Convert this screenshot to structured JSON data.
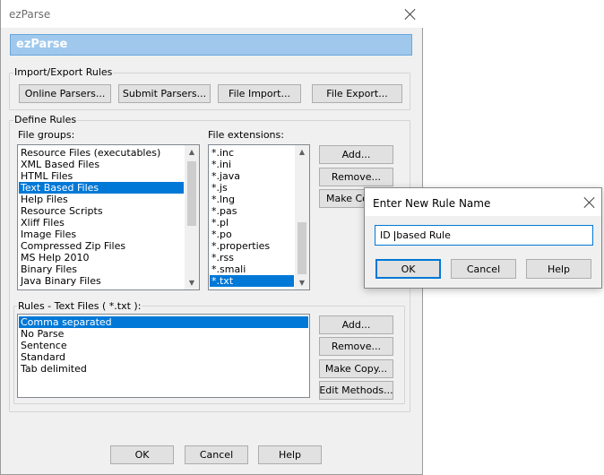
{
  "window": {
    "title": "ezParse"
  },
  "banner": {
    "title": "ezParse"
  },
  "import_export": {
    "label": "Import/Export Rules",
    "buttons": {
      "online": "Online Parsers...",
      "submit": "Submit Parsers...",
      "import": "File Import...",
      "export": "File Export..."
    }
  },
  "define": {
    "label": "Define Rules",
    "file_groups_label": "File groups:",
    "file_extensions_label": "File extensions:",
    "file_groups": [
      "Resource Files (executables)",
      "XML Based Files",
      "HTML Files",
      "Text Based Files",
      "Help Files",
      "Resource Scripts",
      "Xliff Files",
      "Image Files",
      "Compressed Zip Files",
      "MS Help 2010",
      "Binary Files",
      "Java Binary Files"
    ],
    "file_groups_selected": "Text Based Files",
    "file_extensions": [
      "*.inc",
      "*.ini",
      "*.java",
      "*.js",
      "*.lng",
      "*.pas",
      "*.pl",
      "*.po",
      "*.properties",
      "*.rss",
      "*.smali",
      "*.txt"
    ],
    "file_extensions_selected": "*.txt",
    "ext_buttons": {
      "add": "Add...",
      "remove": "Remove...",
      "make_copy": "Make Copy..."
    }
  },
  "rules": {
    "label": "Rules - Text Files ( *.txt ):",
    "items": [
      "Comma separated",
      "No Parse",
      "Sentence",
      "Standard",
      "Tab delimited"
    ],
    "selected": "Comma separated",
    "buttons": {
      "add": "Add...",
      "remove": "Remove...",
      "make_copy": "Make Copy...",
      "edit_methods": "Edit Methods..."
    }
  },
  "footer": {
    "ok": "OK",
    "cancel": "Cancel",
    "help": "Help"
  },
  "dialog": {
    "title": "Enter New Rule Name",
    "input_before_caret": "ID ",
    "input_after_caret": "based Rule",
    "ok": "OK",
    "cancel": "Cancel",
    "help": "Help"
  }
}
